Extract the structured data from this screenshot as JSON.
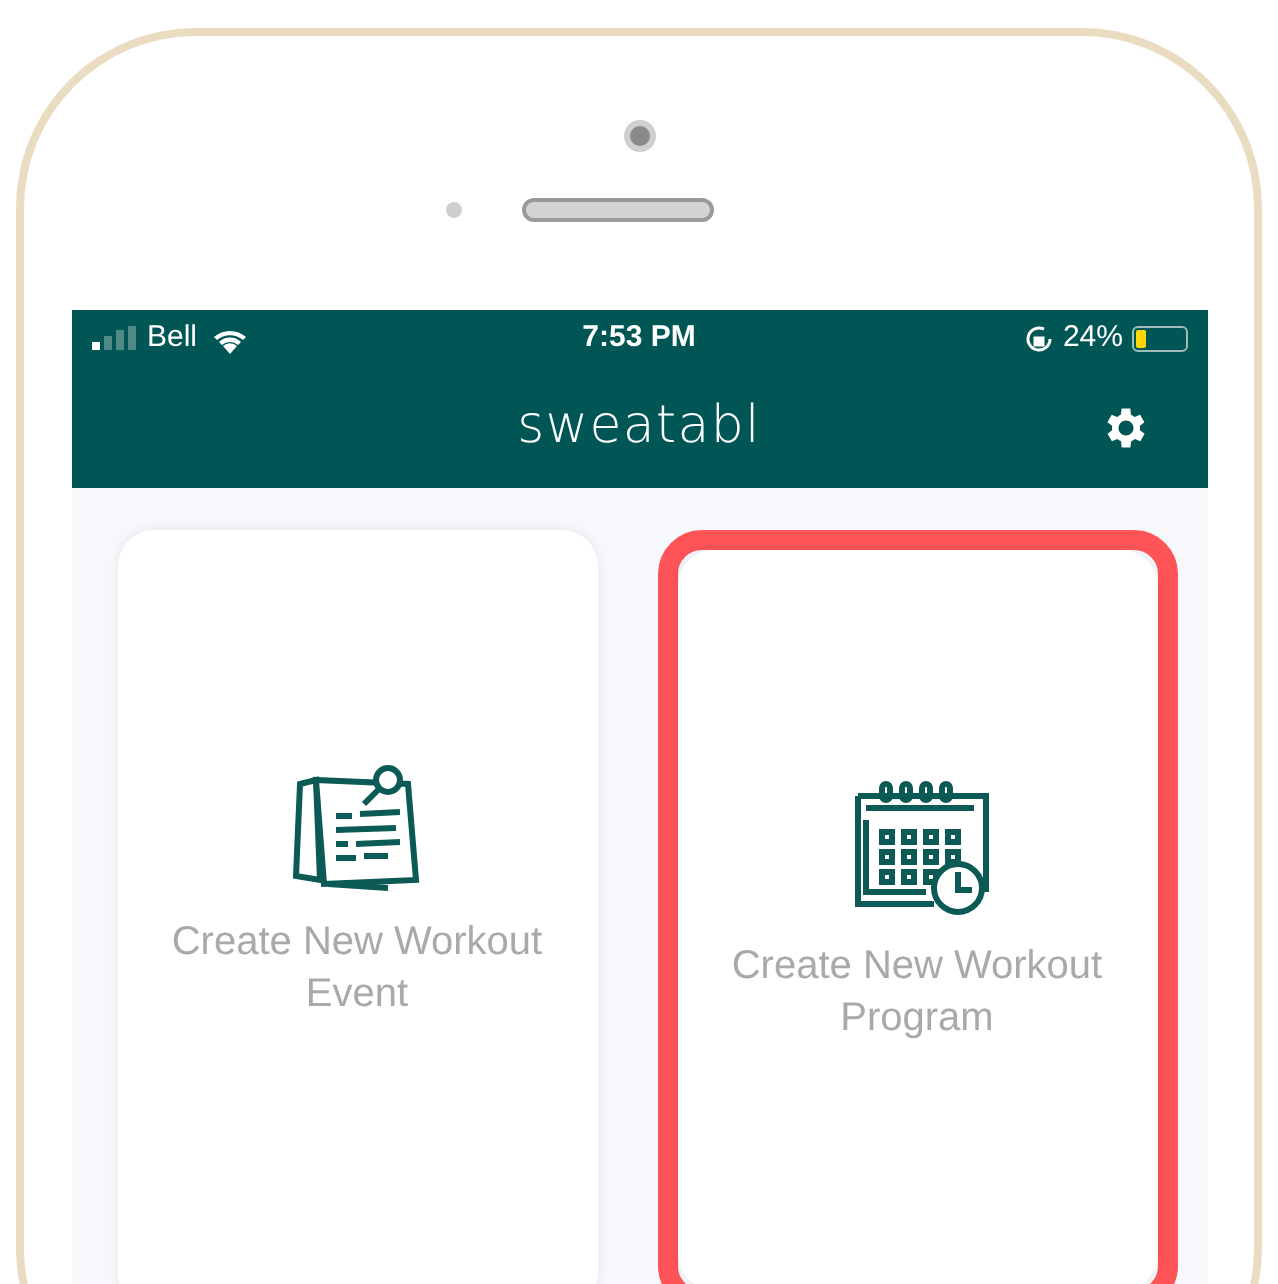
{
  "status_bar": {
    "carrier": "Bell",
    "time": "7:53 PM",
    "battery_percent": "24%",
    "battery": {
      "level": 0.24
    }
  },
  "header": {
    "title": "sweatabl"
  },
  "cards": [
    {
      "kind": "event",
      "label": "Create New Workout Event",
      "highlighted": false
    },
    {
      "kind": "program",
      "label": "Create New Workout Program",
      "highlighted": true
    }
  ]
}
